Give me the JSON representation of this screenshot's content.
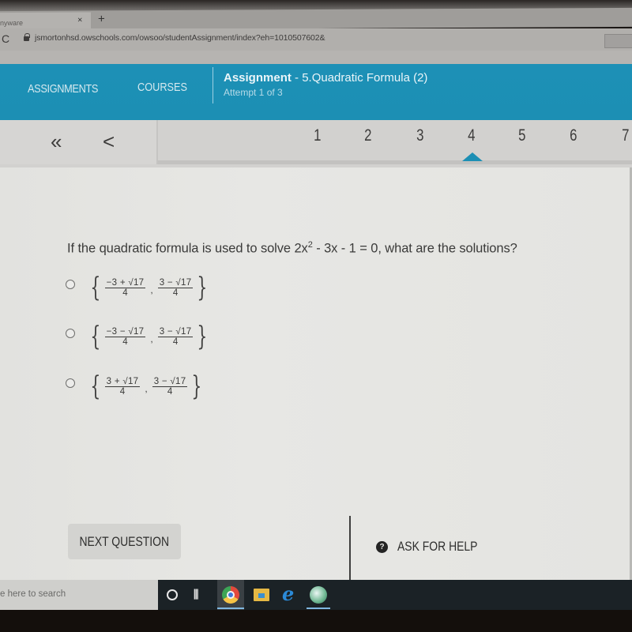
{
  "browser": {
    "tab_title": "nyware",
    "tab_close_glyph": "×",
    "new_tab_glyph": "+",
    "reload_glyph": "C",
    "url": "jsmortonhsd.owschools.com/owsoo/studentAssignment/index?eh=1010507602&"
  },
  "header": {
    "nav": [
      {
        "label": "ASSIGNMENTS"
      },
      {
        "label": "COURSES"
      }
    ],
    "assignment_prefix": "Assignment",
    "assignment_name": " - 5.Quadratic Formula (2)",
    "attempt": "Attempt 1 of 3",
    "accent_color": "#1d8fb4"
  },
  "question_nav": {
    "first_glyph": "«",
    "prev_glyph": "<",
    "pages": [
      "1",
      "2",
      "3",
      "4",
      "5",
      "6",
      "7"
    ],
    "current_page": "4"
  },
  "question": {
    "text_before": "If the quadratic formula is used to solve 2x",
    "exponent": "2",
    "text_after": " - 3x - 1 = 0, what are the solutions?",
    "choices": [
      {
        "n1": "−3 + √17",
        "d1": "4",
        "n2": "3 − √17",
        "d2": "4",
        "selected": false
      },
      {
        "n1": "−3 − √17",
        "d1": "4",
        "n2": "3 − √17",
        "d2": "4",
        "selected": false
      },
      {
        "n1": "3 + √17",
        "d1": "4",
        "n2": "3 − √17",
        "d2": "4",
        "selected": false
      }
    ],
    "open_brace": "{",
    "close_brace": "}",
    "separator": ","
  },
  "footer": {
    "next_label": "NEXT QUESTION",
    "help_label": "ASK FOR HELP",
    "help_icon_glyph": "?"
  },
  "taskbar": {
    "search_placeholder": "e here to search",
    "taskview_glyph": "⫼",
    "ie_glyph": "e",
    "apps": [
      "cortana",
      "task-view",
      "chrome",
      "file-explorer",
      "internet-explorer",
      "globe-app"
    ]
  }
}
